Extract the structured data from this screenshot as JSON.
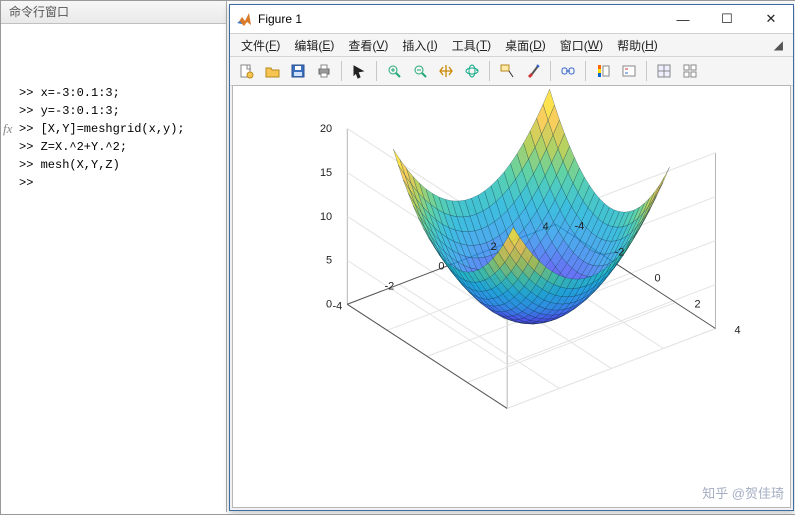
{
  "command_window": {
    "title": "命令行窗口",
    "prompt": ">>",
    "fx_label": "fx",
    "lines": [
      "x=-3:0.1:3;",
      "y=-3:0.1:3;",
      "[X,Y]=meshgrid(x,y);",
      "Z=X.^2+Y.^2;",
      "mesh(X,Y,Z)",
      ""
    ]
  },
  "figure_window": {
    "title": "Figure 1",
    "menu": [
      {
        "label": "文件",
        "u": "F"
      },
      {
        "label": "编辑",
        "u": "E"
      },
      {
        "label": "查看",
        "u": "V"
      },
      {
        "label": "插入",
        "u": "I"
      },
      {
        "label": "工具",
        "u": "T"
      },
      {
        "label": "桌面",
        "u": "D"
      },
      {
        "label": "窗口",
        "u": "W"
      },
      {
        "label": "帮助",
        "u": "H"
      }
    ],
    "win_buttons": {
      "min": "—",
      "max": "☐",
      "close": "✕"
    },
    "toolbar_icons": [
      "new-file-icon",
      "open-icon",
      "save-icon",
      "print-icon",
      "|",
      "arrow-icon",
      "|",
      "zoom-in-icon",
      "zoom-out-icon",
      "pan-icon",
      "rotate3d-icon",
      "|",
      "data-cursor-icon",
      "brush-icon",
      "|",
      "link-icon",
      "|",
      "colorbar-icon",
      "legend-icon",
      "|",
      "grid-icon",
      "subplot-icon"
    ]
  },
  "watermark": "知乎 @贺佳琦",
  "chart_data": {
    "type": "surface-mesh",
    "title": "",
    "equation": "Z = X.^2 + Y.^2",
    "x": {
      "label": "",
      "range": [
        -3,
        3
      ],
      "step": 0.1,
      "ticks": [
        -4,
        -2,
        0,
        2,
        4
      ]
    },
    "y": {
      "label": "",
      "range": [
        -3,
        3
      ],
      "step": 0.1,
      "ticks": [
        -4,
        -2,
        0,
        2,
        4
      ]
    },
    "z": {
      "label": "",
      "range": [
        0,
        18
      ],
      "ticks": [
        0,
        5,
        10,
        15,
        20
      ]
    },
    "colormap": "parula",
    "view": {
      "azimuth": -37.5,
      "elevation": 30
    },
    "grid": true
  }
}
